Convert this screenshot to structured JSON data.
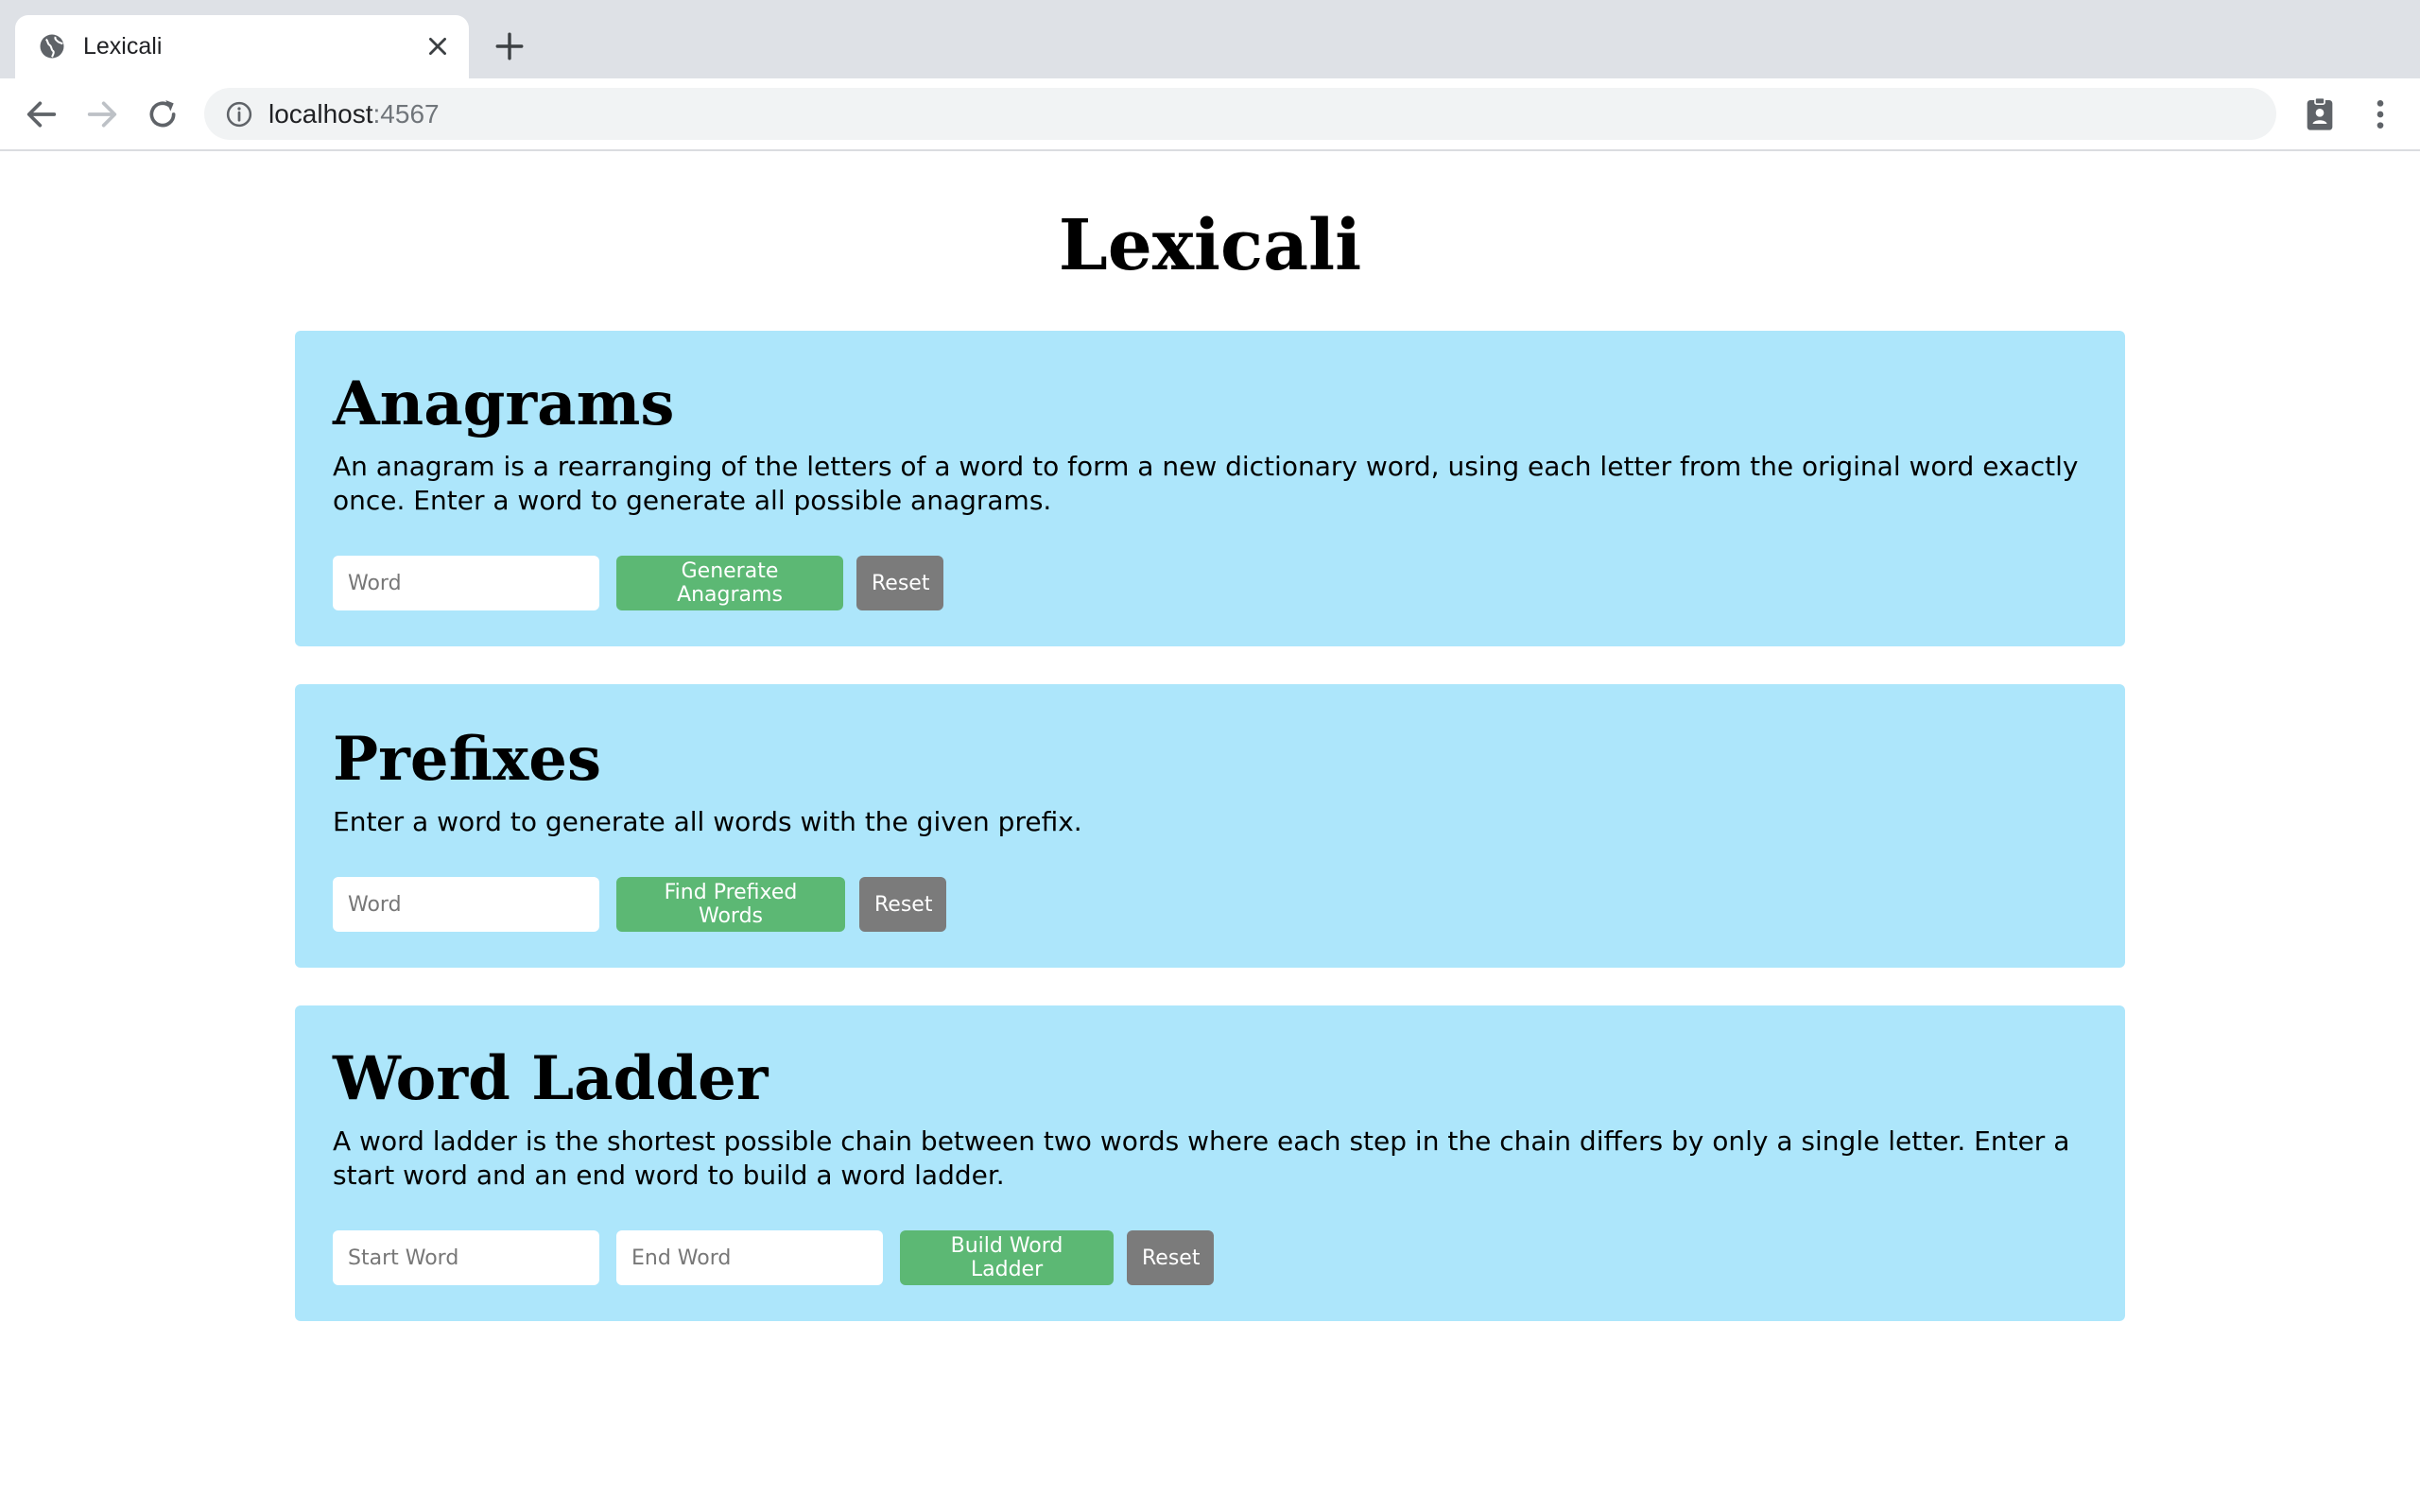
{
  "browser": {
    "tab_title": "Lexicali",
    "url_host": "localhost",
    "url_port": ":4567"
  },
  "page": {
    "title": "Lexicali"
  },
  "anagrams": {
    "heading": "Anagrams",
    "description": "An anagram is a rearranging of the letters of a word to form a new dictionary word, using each letter from the original word exactly once. Enter a word to generate all possible anagrams.",
    "input_placeholder": "Word",
    "submit_label": "Generate Anagrams",
    "reset_label": "Reset"
  },
  "prefixes": {
    "heading": "Prefixes",
    "description": "Enter a word to generate all words with the given prefix.",
    "input_placeholder": "Word",
    "submit_label": "Find Prefixed Words",
    "reset_label": "Reset"
  },
  "word_ladder": {
    "heading": "Word Ladder",
    "description": "A word ladder is the shortest possible chain between two words where each step in the chain differs by only a single letter. Enter a start word and an end word to build a word ladder.",
    "start_placeholder": "Start Word",
    "end_placeholder": "End Word",
    "submit_label": "Build Word Ladder",
    "reset_label": "Reset"
  },
  "colors": {
    "card_background": "#ade6fb",
    "primary_button": "#5cb874",
    "secondary_button": "#7b7b7b"
  }
}
